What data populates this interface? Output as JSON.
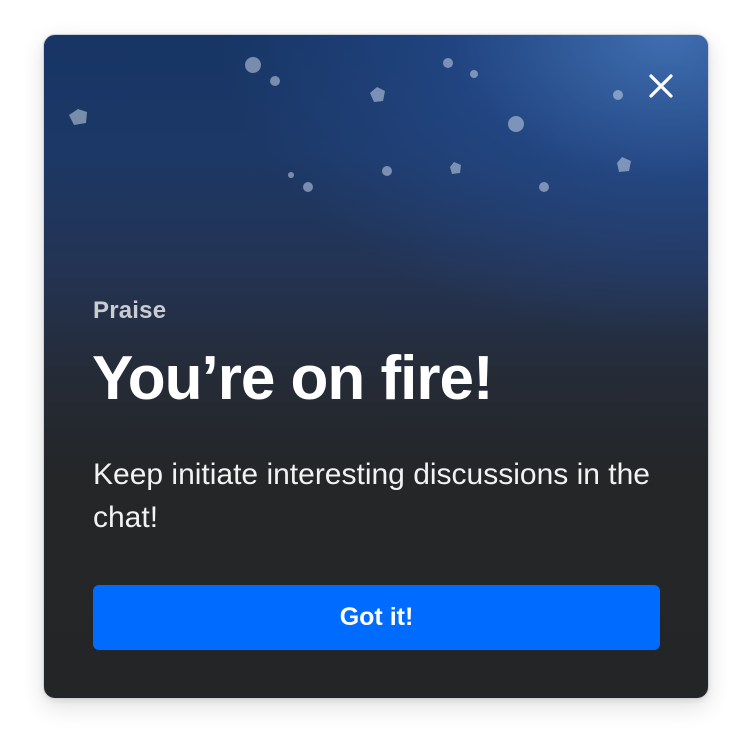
{
  "modal": {
    "eyebrow": "Praise",
    "title": "You’re on fire!",
    "message": "Keep initiate interesting discussions in the chat!",
    "primary_button_label": "Got it!",
    "close_icon": "close-icon",
    "decoration": "confetti"
  },
  "colors": {
    "button_background": "#006bff",
    "button_text": "#ffffff",
    "title_text": "#ffffff",
    "eyebrow_text": "#c9ccd1",
    "background_top": "#173565",
    "background_bottom": "#242526"
  }
}
